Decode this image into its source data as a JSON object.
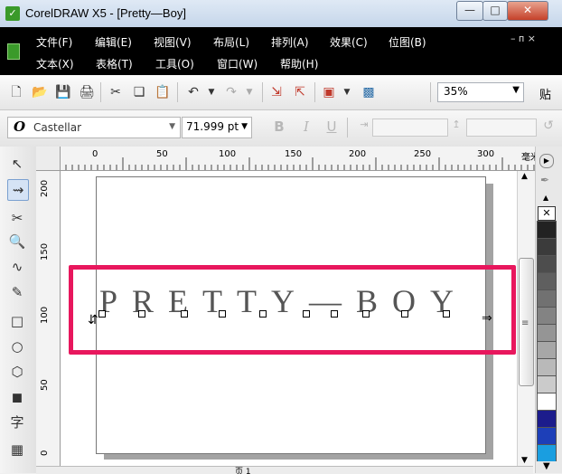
{
  "window": {
    "title": "CorelDRAW X5 - [Pretty—Boy]",
    "minimize": "—",
    "maximize": "□",
    "close": "✕"
  },
  "menus": {
    "row1": [
      "文件(F)",
      "编辑(E)",
      "视图(V)",
      "布局(L)",
      "排列(A)",
      "效果(C)",
      "位图(B)"
    ],
    "row2": [
      "文本(X)",
      "表格(T)",
      "工具(O)",
      "窗口(W)",
      "帮助(H)"
    ],
    "mdi_controls": "–  ᴨ  ×"
  },
  "toolbar": {
    "zoom_value": "35%",
    "paste_label": "贴"
  },
  "property_bar": {
    "font_name": "Castellar",
    "font_size": "71.999 pt",
    "bold": "B",
    "italic": "I",
    "underline": "U"
  },
  "ruler": {
    "h_ticks": [
      "0",
      "50",
      "100",
      "150",
      "200",
      "250",
      "300"
    ],
    "v_ticks": [
      "200",
      "150",
      "100",
      "50",
      "0"
    ],
    "unit": "毫米"
  },
  "canvas": {
    "text": "PRETTY—BOY"
  },
  "tools": {
    "text_tool": "字"
  },
  "palette": [
    "#222222",
    "#3b3b3b",
    "#4d4d4d",
    "#5f5f5f",
    "#717171",
    "#838383",
    "#959595",
    "#a7a7a7",
    "#b9b9b9",
    "#cbcbcb",
    "#ffffff",
    "#1c1c8c",
    "#1d3fb8",
    "#1a9ee0"
  ],
  "colors": {
    "highlight": "#e8175d"
  },
  "status": {
    "page_tab": "页 1"
  }
}
